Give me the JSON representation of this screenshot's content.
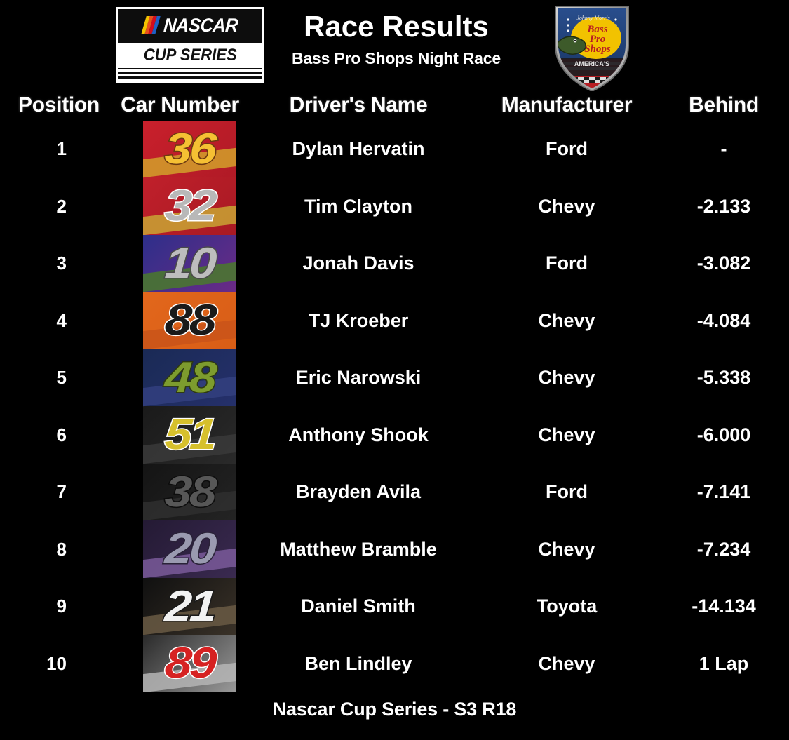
{
  "header": {
    "title": "Race Results",
    "subtitle": "Bass Pro Shops Night Race",
    "nascar_logo": {
      "top_word": "NASCAR",
      "bottom_word": "CUP SERIES"
    },
    "sponsor_logo": {
      "name": "Bass Pro Shops",
      "line1": "Bass",
      "line2": "Pro",
      "line3": "Shops",
      "script": "Johnny Morris",
      "banner": "AMERICA'S"
    }
  },
  "table": {
    "columns": [
      "Position",
      "Car Number",
      "Driver's Name",
      "Manufacturer",
      "Behind"
    ],
    "rows": [
      {
        "position": "1",
        "car": "36",
        "driver": "Dylan Hervatin",
        "manufacturer": "Ford",
        "behind": "-",
        "num_color": "#f5c033",
        "num_outline": "#6d3a11",
        "bg": "#c9202c",
        "bg2": "#b01a26",
        "streak": "#d2a02a"
      },
      {
        "position": "2",
        "car": "32",
        "driver": "Tim Clayton",
        "manufacturer": "Chevy",
        "behind": "-2.133",
        "num_color": "#b8b8b8",
        "num_outline": "#ffffff",
        "bg": "#c0202b",
        "bg2": "#a81923",
        "streak": "#c9a534"
      },
      {
        "position": "3",
        "car": "10",
        "driver": "Jonah Davis",
        "manufacturer": "Ford",
        "behind": "-3.082",
        "num_color": "#bdbdbd",
        "num_outline": "#4a4a4a",
        "bg": "#2d2f8a",
        "bg2": "#6b2a86",
        "streak": "#4a7a2c"
      },
      {
        "position": "4",
        "car": "88",
        "driver": "TJ Kroeber",
        "manufacturer": "Chevy",
        "behind": "-4.084",
        "num_color": "#1a1a1a",
        "num_outline": "#ffffff",
        "bg": "#e2671c",
        "bg2": "#d85d16",
        "streak": "#c9531a"
      },
      {
        "position": "5",
        "car": "48",
        "driver": "Eric Narowski",
        "manufacturer": "Chevy",
        "behind": "-5.338",
        "num_color": "#7d9c2e",
        "num_outline": "#2e3a10",
        "bg": "#1a2a55",
        "bg2": "#25306b",
        "streak": "#33407f"
      },
      {
        "position": "6",
        "car": "51",
        "driver": "Anthony Shook",
        "manufacturer": "Chevy",
        "behind": "-6.000",
        "num_color": "#d6c02c",
        "num_outline": "#ffffff",
        "bg": "#1a1a1a",
        "bg2": "#2a2a2a",
        "streak": "#3a3a3a"
      },
      {
        "position": "7",
        "car": "38",
        "driver": "Brayden Avila",
        "manufacturer": "Ford",
        "behind": "-7.141",
        "num_color": "#575757",
        "num_outline": "#0d0d0d",
        "bg": "#141414",
        "bg2": "#242424",
        "streak": "#2f2f2f"
      },
      {
        "position": "8",
        "car": "20",
        "driver": "Matthew Bramble",
        "manufacturer": "Chevy",
        "behind": "-7.234",
        "num_color": "#9a9ab0",
        "num_outline": "#2a2238",
        "bg": "#241a34",
        "bg2": "#3a2a50",
        "streak": "#7a5a9a"
      },
      {
        "position": "9",
        "car": "21",
        "driver": "Daniel Smith",
        "manufacturer": "Toyota",
        "behind": "-14.134",
        "num_color": "#f2f2f2",
        "num_outline": "#1a1a1a",
        "bg": "#101010",
        "bg2": "#3a3228",
        "streak": "#6a5a44"
      },
      {
        "position": "10",
        "car": "89",
        "driver": "Ben Lindley",
        "manufacturer": "Chevy",
        "behind": "1 Lap",
        "num_color": "#d62222",
        "num_outline": "#ffffff",
        "bg": "#2a2a2a",
        "bg2": "#9a9a9a",
        "streak": "#b5b5b5"
      }
    ]
  },
  "footer": {
    "text": "Nascar Cup Series - S3 R18"
  },
  "colors": {
    "background": "#000000",
    "text": "#ffffff",
    "nascar_red": "#d40b1e",
    "nascar_blue": "#1f5fc4",
    "nascar_yellow": "#f4c300",
    "bps_yellow": "#f2c200",
    "bps_blue": "#1d3a6e",
    "bps_red": "#b81c22"
  }
}
